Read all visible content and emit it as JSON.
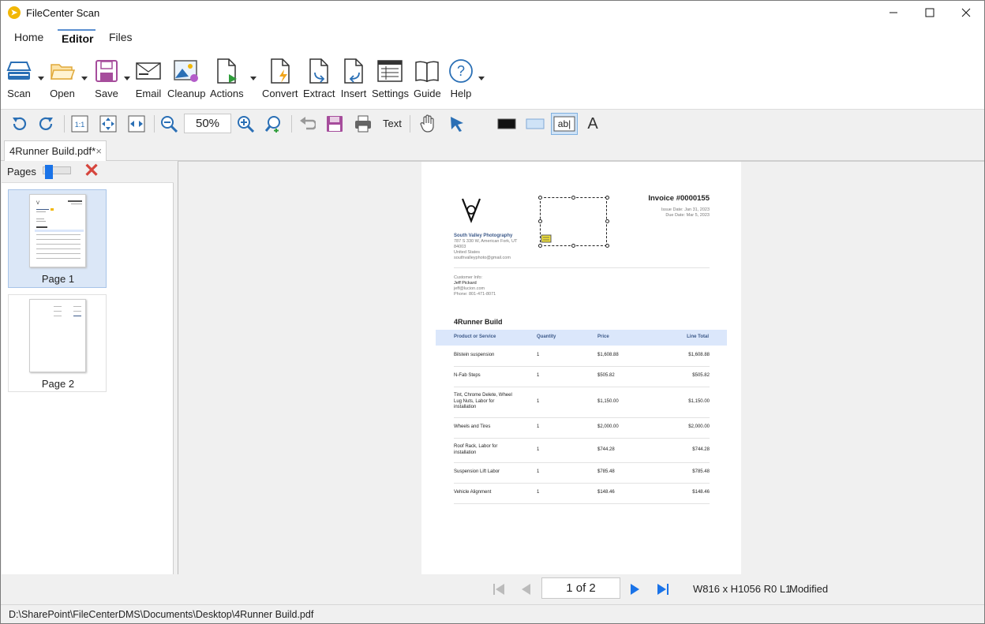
{
  "window": {
    "title": "FileCenter Scan"
  },
  "tabs": [
    {
      "label": "Home"
    },
    {
      "label": "Editor"
    },
    {
      "label": "Files"
    }
  ],
  "ribbon": {
    "scan": "Scan",
    "open": "Open",
    "save": "Save",
    "email": "Email",
    "cleanup": "Cleanup",
    "actions": "Actions",
    "convert": "Convert",
    "extract": "Extract",
    "insert": "Insert",
    "settings": "Settings",
    "guide": "Guide",
    "help": "Help"
  },
  "toolbar": {
    "zoom": "50%",
    "text_label": "Text",
    "text_field_glyph": "ab|",
    "font_glyph": "A"
  },
  "doc_tab": {
    "name": "4Runner Build.pdf*",
    "close": "×"
  },
  "pages_panel": {
    "label": "Pages",
    "pages": [
      {
        "label": "Page 1"
      },
      {
        "label": "Page 2"
      }
    ]
  },
  "invoice": {
    "title": "Invoice #0000155",
    "issue_date": "Issue Date: Jan 31, 2023",
    "due_date": "Due Date: Mar 5, 2023",
    "company": "South Valley Photography",
    "address1": "787 S 330 W, American Fork, UT",
    "address2": "84003",
    "address3": "United States",
    "email": "southvalleyphoto@gmail.com",
    "customer_label": "Customer Info:",
    "customer_name": "Jeff Pickard",
    "customer_email": "jeff@lucion.com",
    "customer_phone": "Phone: 801-471-8071",
    "section": "4Runner Build",
    "headers": {
      "product": "Product or Service",
      "quantity": "Quantity",
      "price": "Price",
      "total": "Line Total"
    },
    "rows": [
      {
        "product": [
          "Bilstein suspension"
        ],
        "qty": "1",
        "price": "$1,608.88",
        "total": "$1,608.88"
      },
      {
        "product": [
          "N-Fab Steps"
        ],
        "qty": "1",
        "price": "$505.82",
        "total": "$505.82"
      },
      {
        "product": [
          "Tint, Chrome Delete, Wheel",
          "Lug Nuts, Labor for",
          "installation"
        ],
        "qty": "1",
        "price": "$1,150.00",
        "total": "$1,150.00"
      },
      {
        "product": [
          "Wheels and Tires"
        ],
        "qty": "1",
        "price": "$2,000.00",
        "total": "$2,000.00"
      },
      {
        "product": [
          "Roof Rack, Labor for",
          "installation"
        ],
        "qty": "1",
        "price": "$744.28",
        "total": "$744.28"
      },
      {
        "product": [
          "Suspension Lift Labor"
        ],
        "qty": "1",
        "price": "$785.48",
        "total": "$785.48"
      },
      {
        "product": [
          "Vehicle Alignment"
        ],
        "qty": "1",
        "price": "$148.46",
        "total": "$148.46"
      }
    ]
  },
  "navigation": {
    "page_indicator": "1 of 2",
    "dimensions": "W816 x H1056  R0  L1",
    "status": "Modified"
  },
  "statusbar": {
    "path": "D:\\SharePoint\\FileCenterDMS\\Documents\\Desktop\\4Runner Build.pdf"
  },
  "colors": {
    "accent": "#1a73e8",
    "selection": "#dbe7f7",
    "table_header": "#dbe7fb",
    "close_red": "#d6453d"
  }
}
